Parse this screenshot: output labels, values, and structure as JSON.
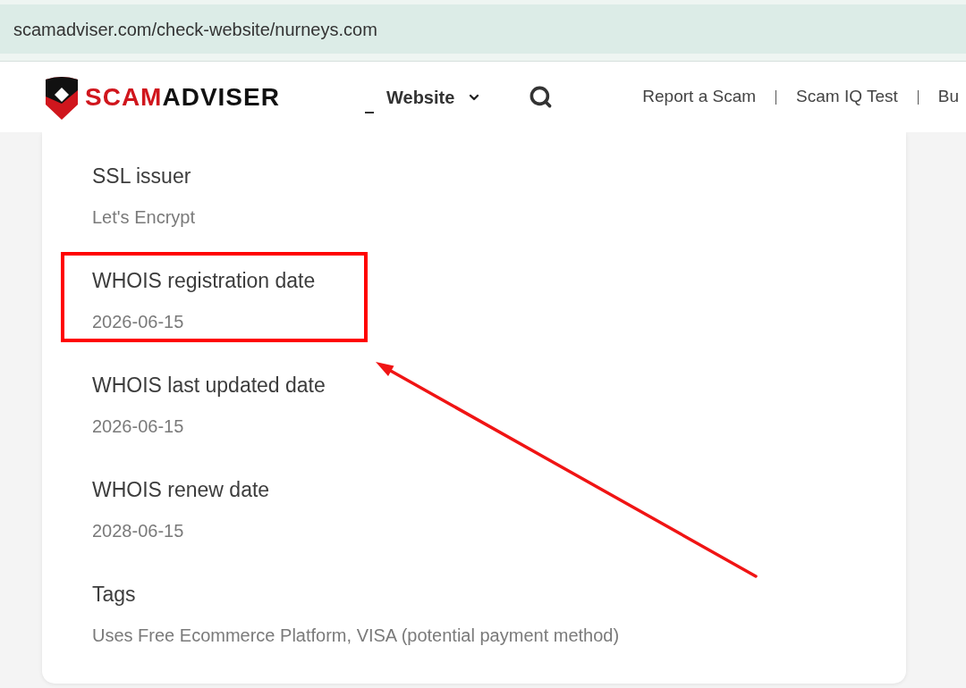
{
  "browser": {
    "url": "scamadviser.com/check-website/nurneys.com"
  },
  "header": {
    "logo": {
      "part_1": "SCAM",
      "part_2": "ADVISER"
    },
    "menu": {
      "label": "Website"
    },
    "links": [
      "Report a Scam",
      "Scam IQ Test",
      "Bu"
    ]
  },
  "details": [
    {
      "label": "SSL issuer",
      "value": "Let's Encrypt",
      "highlighted": false
    },
    {
      "label": "WHOIS registration date",
      "value": "2026-06-15",
      "highlighted": true
    },
    {
      "label": "WHOIS last updated date",
      "value": "2026-06-15",
      "highlighted": false
    },
    {
      "label": "WHOIS renew date",
      "value": "2028-06-15",
      "highlighted": false
    },
    {
      "label": "Tags",
      "value": "Uses Free Ecommerce Platform, VISA (potential payment method)",
      "highlighted": false
    }
  ]
}
